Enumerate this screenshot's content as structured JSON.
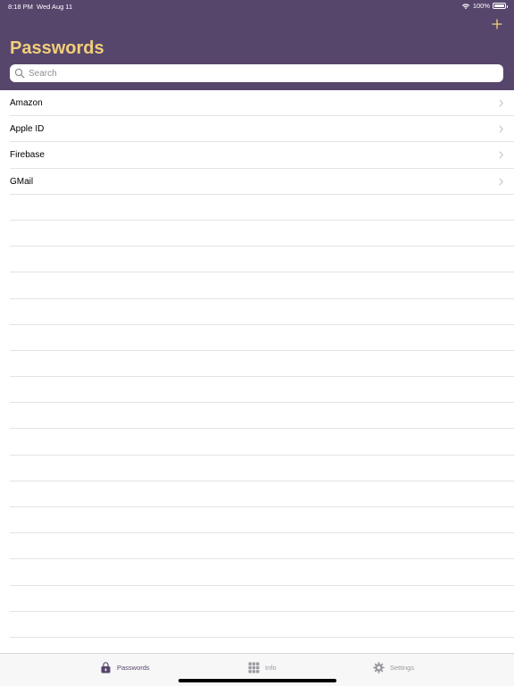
{
  "status_bar": {
    "time": "8:18 PM",
    "date": "Wed Aug 11",
    "battery": "100%"
  },
  "header": {
    "title": "Passwords",
    "background_color": "#57466c",
    "title_color": "#f2cf79",
    "add_icon": "plus-icon"
  },
  "search": {
    "placeholder": "Search",
    "value": ""
  },
  "list": {
    "items": [
      {
        "label": "Amazon"
      },
      {
        "label": "Apple ID"
      },
      {
        "label": "Firebase"
      },
      {
        "label": "GMail"
      }
    ]
  },
  "tab_bar": {
    "tabs": [
      {
        "label": "Passwords",
        "icon": "lock-box-icon",
        "selected": true
      },
      {
        "label": "Info",
        "icon": "grid-icon",
        "selected": false
      },
      {
        "label": "Settings",
        "icon": "gear-icon",
        "selected": false
      }
    ]
  }
}
